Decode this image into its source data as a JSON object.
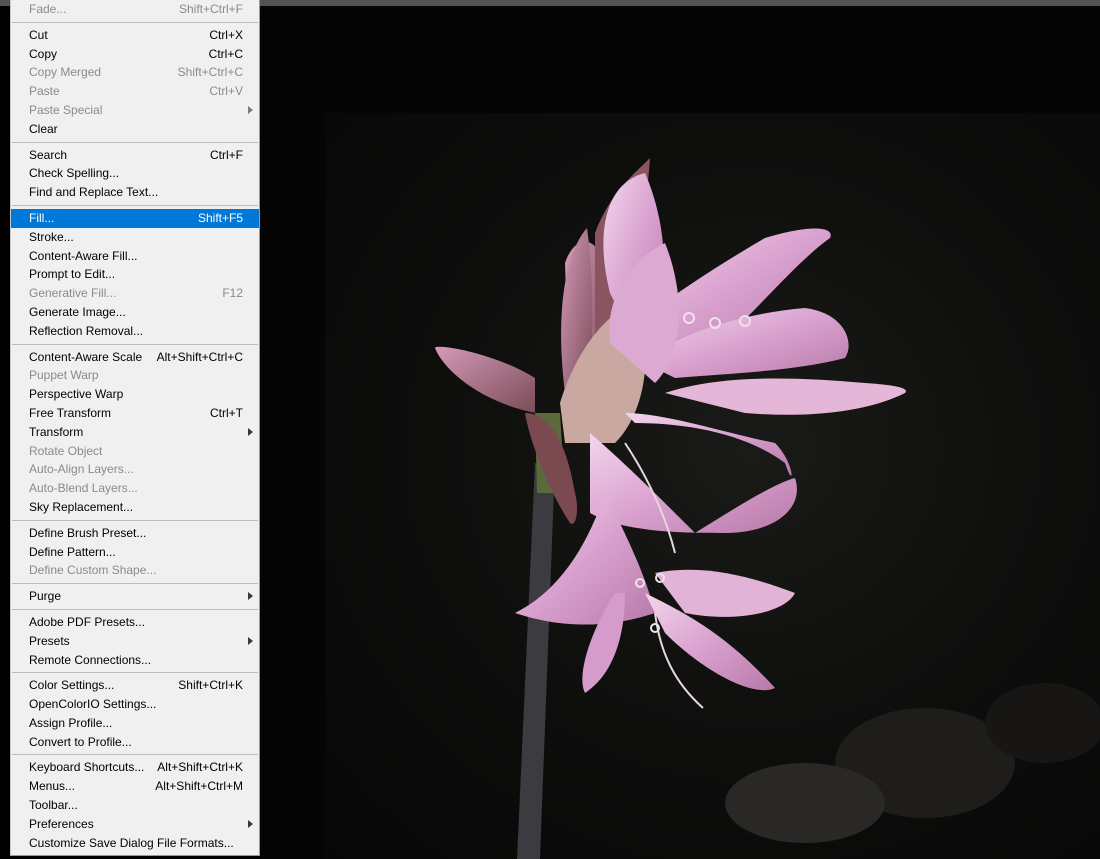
{
  "colors": {
    "menu_bg": "#f0f0f0",
    "highlight": "#0078d7",
    "disabled_text": "#8a8a8a",
    "canvas_bg": "#000000"
  },
  "edit_menu": {
    "items": [
      {
        "label": "Fade...",
        "shortcut": "Shift+Ctrl+F",
        "disabled": true
      },
      {
        "separator": true
      },
      {
        "label": "Cut",
        "shortcut": "Ctrl+X"
      },
      {
        "label": "Copy",
        "shortcut": "Ctrl+C"
      },
      {
        "label": "Copy Merged",
        "shortcut": "Shift+Ctrl+C",
        "disabled": true
      },
      {
        "label": "Paste",
        "shortcut": "Ctrl+V",
        "disabled": true
      },
      {
        "label": "Paste Special",
        "submenu": true,
        "disabled": true
      },
      {
        "label": "Clear"
      },
      {
        "separator": true
      },
      {
        "label": "Search",
        "shortcut": "Ctrl+F"
      },
      {
        "label": "Check Spelling..."
      },
      {
        "label": "Find and Replace Text..."
      },
      {
        "separator": true
      },
      {
        "label": "Fill...",
        "shortcut": "Shift+F5",
        "active": true
      },
      {
        "label": "Stroke..."
      },
      {
        "label": "Content-Aware Fill..."
      },
      {
        "label": "Prompt to Edit..."
      },
      {
        "label": "Generative Fill...",
        "shortcut": "F12",
        "disabled": true
      },
      {
        "label": "Generate Image..."
      },
      {
        "label": "Reflection Removal..."
      },
      {
        "separator": true
      },
      {
        "label": "Content-Aware Scale",
        "shortcut": "Alt+Shift+Ctrl+C"
      },
      {
        "label": "Puppet Warp",
        "disabled": true
      },
      {
        "label": "Perspective Warp"
      },
      {
        "label": "Free Transform",
        "shortcut": "Ctrl+T"
      },
      {
        "label": "Transform",
        "submenu": true
      },
      {
        "label": "Rotate Object",
        "disabled": true
      },
      {
        "label": "Auto-Align Layers...",
        "disabled": true
      },
      {
        "label": "Auto-Blend Layers...",
        "disabled": true
      },
      {
        "label": "Sky Replacement..."
      },
      {
        "separator": true
      },
      {
        "label": "Define Brush Preset..."
      },
      {
        "label": "Define Pattern..."
      },
      {
        "label": "Define Custom Shape...",
        "disabled": true
      },
      {
        "separator": true
      },
      {
        "label": "Purge",
        "submenu": true
      },
      {
        "separator": true
      },
      {
        "label": "Adobe PDF Presets..."
      },
      {
        "label": "Presets",
        "submenu": true
      },
      {
        "label": "Remote Connections..."
      },
      {
        "separator": true
      },
      {
        "label": "Color Settings...",
        "shortcut": "Shift+Ctrl+K"
      },
      {
        "label": "OpenColorIO Settings..."
      },
      {
        "label": "Assign Profile..."
      },
      {
        "label": "Convert to Profile..."
      },
      {
        "separator": true
      },
      {
        "label": "Keyboard Shortcuts...",
        "shortcut": "Alt+Shift+Ctrl+K"
      },
      {
        "label": "Menus...",
        "shortcut": "Alt+Shift+Ctrl+M"
      },
      {
        "label": "Toolbar..."
      },
      {
        "label": "Preferences",
        "submenu": true
      },
      {
        "label": "Customize Save Dialog File Formats..."
      }
    ]
  }
}
